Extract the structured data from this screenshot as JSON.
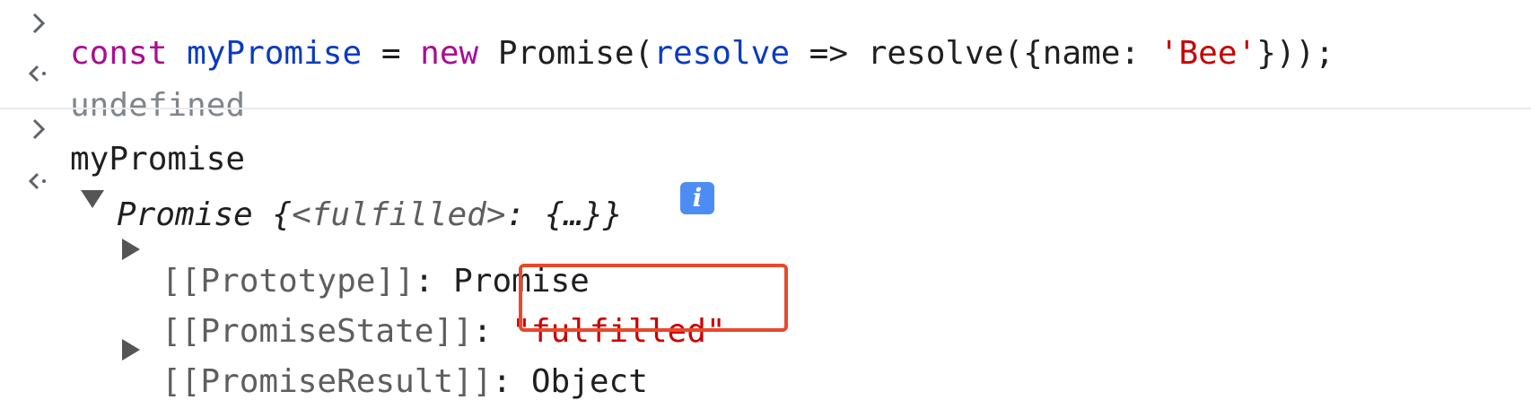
{
  "console": {
    "line1": {
      "kw_const": "const",
      "var_name": "myPromise",
      "eq": " = ",
      "kw_new": "new",
      "ctor": " Promise(",
      "param": "resolve",
      "arrow": " => resolve({name: ",
      "str": "'Bee'",
      "close": "}));"
    },
    "line2": {
      "result": "undefined"
    },
    "line3": {
      "input": "myPromise"
    },
    "line4": {
      "label": "Promise",
      "body_open": " {",
      "state_tag": "<fulfilled>",
      "body_rest": ": {…}}",
      "info_glyph": "i"
    },
    "props": [
      {
        "key": "[[Prototype]]",
        "sep": ": ",
        "value": "Promise"
      },
      {
        "key": "[[PromiseState]]",
        "sep": ": ",
        "value": "\"fulfilled\""
      },
      {
        "key": "[[PromiseResult]]",
        "sep": ": ",
        "value": "Object"
      }
    ]
  },
  "icons": {
    "input_prompt": "chevron-right-icon",
    "output_return": "return-arrow-icon",
    "expand_open": "triangle-down-icon",
    "expand_closed": "triangle-right-icon",
    "info": "info-icon"
  },
  "colors": {
    "keyword": "#aa0d91",
    "identifier": "#0b3bbf",
    "string": "#c80000",
    "muted": "#80868b",
    "highlight_border": "#e8492b",
    "info_badge": "#4c8df5"
  }
}
